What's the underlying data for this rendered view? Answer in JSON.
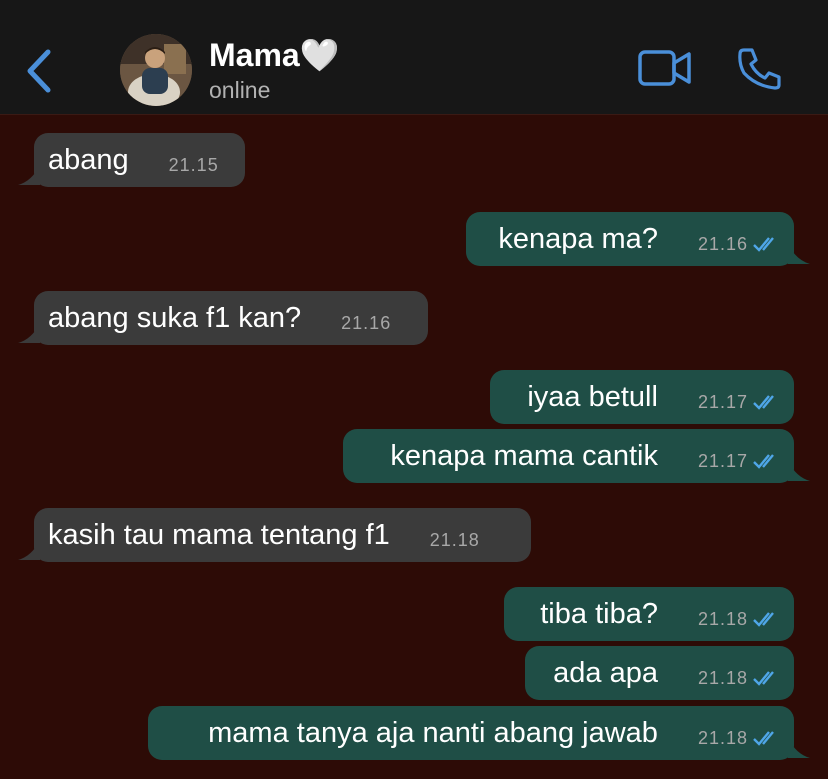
{
  "header": {
    "contact_name": "Mama",
    "heart_emoji": "🤍",
    "status": "online"
  },
  "colors": {
    "accent": "#4a8fd9",
    "incoming_bubble": "#3b3b3b",
    "outgoing_bubble": "#1f4e46",
    "chat_background": "#2d0b06",
    "header_background": "#171717",
    "read_ticks": "#4fa6e8"
  },
  "icons": {
    "back": "chevron-left-icon",
    "video": "video-camera-icon",
    "phone": "phone-icon",
    "read_receipt": "double-check-icon"
  },
  "messages": [
    {
      "direction": "in",
      "text": "abang",
      "time": "21.15"
    },
    {
      "direction": "out",
      "text": "kenapa ma?",
      "time": "21.16",
      "read": true
    },
    {
      "direction": "in",
      "text": "abang suka f1 kan?",
      "time": "21.16"
    },
    {
      "direction": "out",
      "text": "iyaa betull",
      "time": "21.17",
      "read": true
    },
    {
      "direction": "out",
      "text": "kenapa mama cantik",
      "time": "21.17",
      "read": true
    },
    {
      "direction": "in",
      "text": "kasih tau mama tentang f1",
      "time": "21.18"
    },
    {
      "direction": "out",
      "text": "tiba tiba?",
      "time": "21.18",
      "read": true
    },
    {
      "direction": "out",
      "text": "ada apa",
      "time": "21.18",
      "read": true
    },
    {
      "direction": "out",
      "text": "mama tanya aja nanti abang jawab",
      "time": "21.18",
      "read": true
    }
  ]
}
